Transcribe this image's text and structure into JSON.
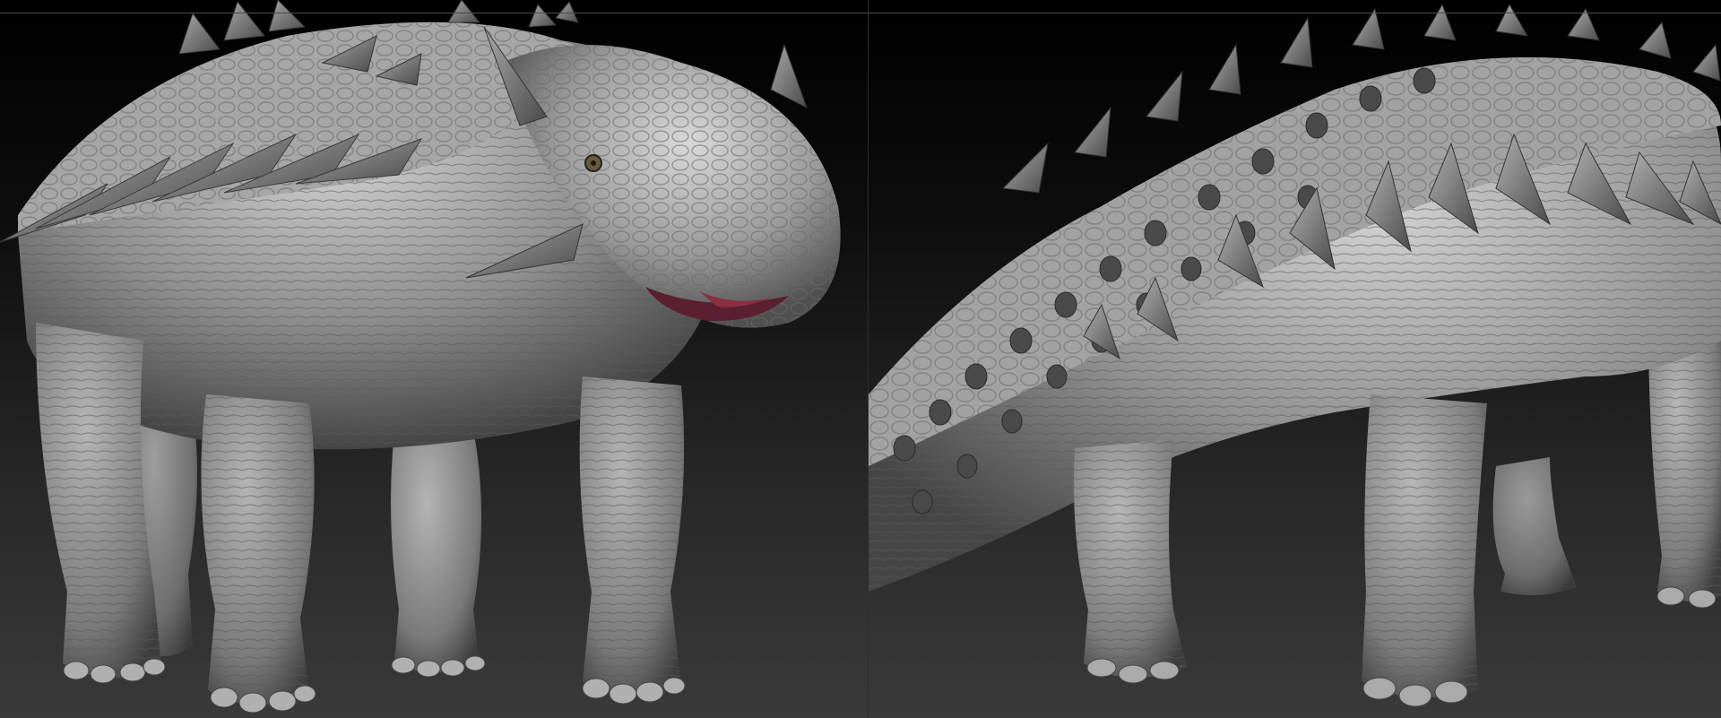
{
  "app": {
    "description_visible_text": ""
  },
  "viewports": [
    {
      "subject": "ankylosaur-sculpt-front-three-quarter-view"
    },
    {
      "subject": "ankylosaur-sculpt-rear-three-quarter-view"
    }
  ],
  "colors": {
    "background_top": "#000000",
    "background_bottom": "#3a3a3a",
    "sculpt_clay": "#8c8c8c",
    "sculpt_highlight": "#c8c8c8",
    "sculpt_shadow": "#3c3c3c",
    "mouth_interior": "#7a2a3a"
  },
  "icons": [
    "dinosaur-model-front",
    "dinosaur-model-rear"
  ]
}
